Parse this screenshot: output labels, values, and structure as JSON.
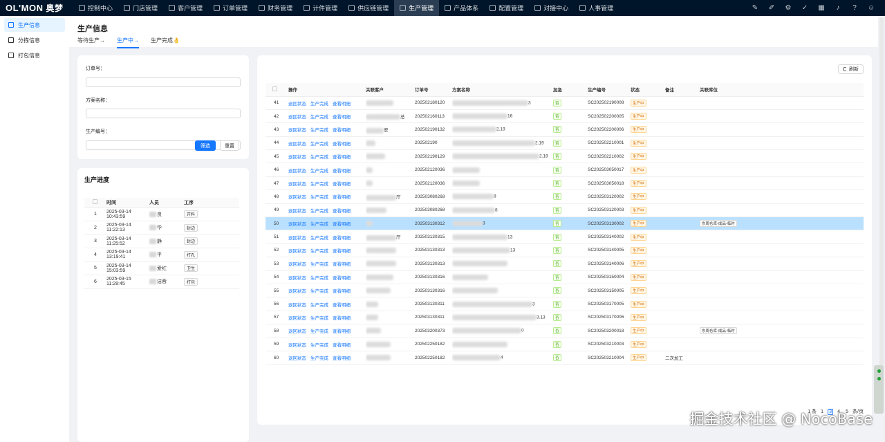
{
  "brand": {
    "logo": "OL'MON",
    "logo_cn": "奥梦"
  },
  "nav": [
    {
      "label": "控制中心",
      "icon": "dashboard-icon"
    },
    {
      "label": "门店管理",
      "icon": "store-icon"
    },
    {
      "label": "客户管理",
      "icon": "customer-icon"
    },
    {
      "label": "订单管理",
      "icon": "order-icon"
    },
    {
      "label": "财务管理",
      "icon": "finance-icon"
    },
    {
      "label": "计件管理",
      "icon": "piecework-icon"
    },
    {
      "label": "供应链管理",
      "icon": "supply-chain-icon"
    },
    {
      "label": "生产管理",
      "icon": "gear-icon",
      "active": true
    },
    {
      "label": "产品体系",
      "icon": "product-icon"
    },
    {
      "label": "配置管理",
      "icon": "config-icon"
    },
    {
      "label": "对接中心",
      "icon": "link-icon"
    },
    {
      "label": "人事管理",
      "icon": "user-icon"
    }
  ],
  "toolbar_icons": [
    "brush-icon",
    "pin-icon",
    "settings-icon",
    "check-circle-icon",
    "grid-icon",
    "bell-icon",
    "help-icon",
    "user-avatar-icon"
  ],
  "sidebar": [
    {
      "label": "生产信息",
      "active": true
    },
    {
      "label": "分拣信息"
    },
    {
      "label": "打包信息"
    }
  ],
  "page": {
    "title": "生产信息",
    "tabs": [
      {
        "label": "等待生产→"
      },
      {
        "label": "生产中→",
        "active": true
      },
      {
        "label": "生产完成👌"
      }
    ]
  },
  "filter": {
    "order_no_label": "订单号：",
    "plan_name_label": "方案名称：",
    "prod_no_label": "生产编号：",
    "search_label": "筛选",
    "reset_label": "重置"
  },
  "progress": {
    "title": "生产进度",
    "headers": [
      "时间",
      "人员",
      "工序"
    ],
    "rows": [
      {
        "no": "1",
        "time": "2025-03-14 10:43:59",
        "person": "良",
        "step": "开料"
      },
      {
        "no": "2",
        "time": "2025-03-14 11:22:13",
        "person": "华",
        "step": "封边"
      },
      {
        "no": "3",
        "time": "2025-03-14 11:25:52",
        "person": "静",
        "step": "封边"
      },
      {
        "no": "4",
        "time": "2025-03-14 13:19:41",
        "person": "平",
        "step": "打孔"
      },
      {
        "no": "5",
        "time": "2025-03-14 15:03:59",
        "person": "爱红",
        "step": "卫生"
      },
      {
        "no": "6",
        "time": "2025-03-15 11:28:45",
        "person": "洁蓉",
        "step": "打包"
      }
    ]
  },
  "main_table": {
    "refresh_label": "刷新",
    "headers": [
      "操作",
      "关联客户",
      "订单号",
      "方案名称",
      "加急",
      "生产编号",
      "状态",
      "备注",
      "关联库位"
    ],
    "action_labels": [
      "退回状态",
      "生产完成",
      "查看明细"
    ],
    "rows": [
      {
        "no": "41",
        "customer": "",
        "order_no": "202502180120",
        "plan_suffix": "3",
        "urgent": "否",
        "prod_no": "SC202502190008",
        "status": "生产中",
        "note": "",
        "location": ""
      },
      {
        "no": "42",
        "customer": "总",
        "order_no": "202502160113",
        "plan_suffix": "16",
        "urgent": "否",
        "prod_no": "SC202502200005",
        "status": "生产中",
        "note": "",
        "location": ""
      },
      {
        "no": "43",
        "customer": "安",
        "order_no": "202502190132",
        "plan_suffix": "2.19",
        "urgent": "否",
        "prod_no": "SC202502200006",
        "status": "生产中",
        "note": "",
        "location": ""
      },
      {
        "no": "44",
        "customer": "",
        "order_no": "202502190",
        "plan_suffix": "2.19",
        "urgent": "否",
        "prod_no": "SC202502210001",
        "status": "生产中",
        "note": "",
        "location": ""
      },
      {
        "no": "45",
        "customer": "",
        "order_no": "202502190129",
        "plan_suffix": "2.19",
        "urgent": "否",
        "prod_no": "SC202502210002",
        "status": "生产中",
        "note": "",
        "location": ""
      },
      {
        "no": "46",
        "customer": "",
        "order_no": "202502120036",
        "plan_suffix": "",
        "urgent": "否",
        "prod_no": "SC202503050017",
        "status": "生产中",
        "note": "",
        "location": ""
      },
      {
        "no": "47",
        "customer": "",
        "order_no": "202502120036",
        "plan_suffix": "",
        "urgent": "否",
        "prod_no": "SC202503050018",
        "status": "生产中",
        "note": "",
        "location": ""
      },
      {
        "no": "48",
        "customer": "厅",
        "order_no": "202503080268",
        "plan_suffix": "8",
        "urgent": "否",
        "prod_no": "SC202503120002",
        "status": "生产中",
        "note": "",
        "location": ""
      },
      {
        "no": "49",
        "customer": "",
        "order_no": "202503080268",
        "plan_suffix": "8",
        "urgent": "否",
        "prod_no": "SC202503120003",
        "status": "生产中",
        "note": "",
        "location": ""
      },
      {
        "no": "50",
        "customer": "",
        "order_no": "202503130312",
        "plan_suffix": "3",
        "urgent": "否",
        "prod_no": "SC202503130002",
        "status": "生产中",
        "note": "",
        "location": "东周仓库-成品-临时",
        "highlight": true
      },
      {
        "no": "51",
        "customer": "厅",
        "order_no": "202503130315",
        "plan_suffix": "13",
        "urgent": "否",
        "prod_no": "SC202503140002",
        "status": "生产中",
        "note": "",
        "location": ""
      },
      {
        "no": "52",
        "customer": "",
        "order_no": "202503130313",
        "plan_suffix": "13",
        "urgent": "否",
        "prod_no": "SC202503140005",
        "status": "生产中",
        "note": "",
        "location": ""
      },
      {
        "no": "53",
        "customer": "",
        "order_no": "202503130313",
        "plan_suffix": "",
        "urgent": "否",
        "prod_no": "SC202503140006",
        "status": "生产中",
        "note": "",
        "location": ""
      },
      {
        "no": "54",
        "customer": "",
        "order_no": "202503130316",
        "plan_suffix": "",
        "urgent": "否",
        "prod_no": "SC202503150004",
        "status": "生产中",
        "note": "",
        "location": ""
      },
      {
        "no": "55",
        "customer": "",
        "order_no": "202503130316",
        "plan_suffix": "",
        "urgent": "否",
        "prod_no": "SC202503150005",
        "status": "生产中",
        "note": "",
        "location": ""
      },
      {
        "no": "56",
        "customer": "",
        "order_no": "202503130311",
        "plan_suffix": "3",
        "urgent": "否",
        "prod_no": "SC202503170005",
        "status": "生产中",
        "note": "",
        "location": ""
      },
      {
        "no": "57",
        "customer": "",
        "order_no": "202503130311",
        "plan_suffix": "3.13",
        "urgent": "否",
        "prod_no": "SC202503170006",
        "status": "生产中",
        "note": "",
        "location": ""
      },
      {
        "no": "58",
        "customer": "",
        "order_no": "202503200373",
        "plan_suffix": "0",
        "urgent": "否",
        "prod_no": "SC202503200018",
        "status": "生产中",
        "note": "",
        "location": "东周仓库-成品-临时"
      },
      {
        "no": "59",
        "customer": "",
        "order_no": "202502250182",
        "plan_suffix": "",
        "urgent": "否",
        "prod_no": "SC202503210003",
        "status": "生产中",
        "note": "",
        "location": ""
      },
      {
        "no": "60",
        "customer": "",
        "order_no": "202502250182",
        "plan_suffix": "4",
        "urgent": "否",
        "prod_no": "SC202503210004",
        "status": "生产中",
        "note": "二次加工",
        "location": ""
      }
    ]
  },
  "pagination": {
    "total_text": "1 条",
    "pages": [
      "1",
      "3",
      "4",
      "5"
    ],
    "active_page": "3",
    "size_text": "条/页"
  },
  "watermark": "掘金技术社区 @ NocoBase"
}
